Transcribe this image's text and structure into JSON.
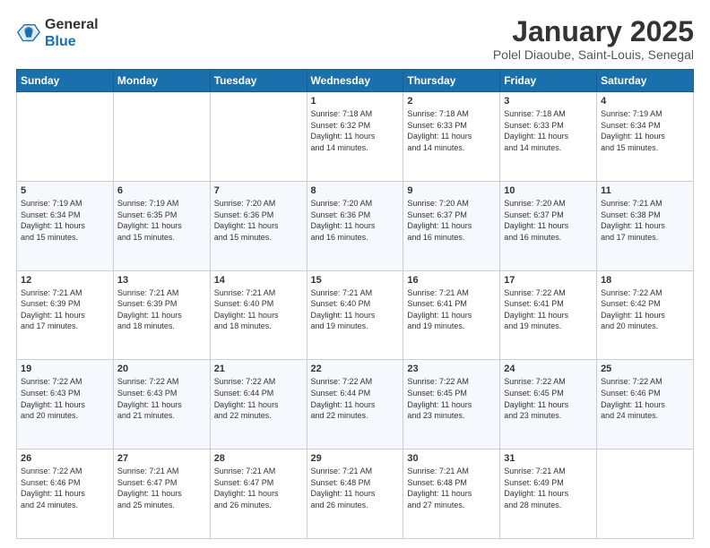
{
  "header": {
    "logo_line1": "General",
    "logo_line2": "Blue",
    "title": "January 2025",
    "subtitle": "Polel Diaoube, Saint-Louis, Senegal"
  },
  "weekdays": [
    "Sunday",
    "Monday",
    "Tuesday",
    "Wednesday",
    "Thursday",
    "Friday",
    "Saturday"
  ],
  "weeks": [
    [
      {
        "day": "",
        "info": ""
      },
      {
        "day": "",
        "info": ""
      },
      {
        "day": "",
        "info": ""
      },
      {
        "day": "1",
        "info": "Sunrise: 7:18 AM\nSunset: 6:32 PM\nDaylight: 11 hours\nand 14 minutes."
      },
      {
        "day": "2",
        "info": "Sunrise: 7:18 AM\nSunset: 6:33 PM\nDaylight: 11 hours\nand 14 minutes."
      },
      {
        "day": "3",
        "info": "Sunrise: 7:18 AM\nSunset: 6:33 PM\nDaylight: 11 hours\nand 14 minutes."
      },
      {
        "day": "4",
        "info": "Sunrise: 7:19 AM\nSunset: 6:34 PM\nDaylight: 11 hours\nand 15 minutes."
      }
    ],
    [
      {
        "day": "5",
        "info": "Sunrise: 7:19 AM\nSunset: 6:34 PM\nDaylight: 11 hours\nand 15 minutes."
      },
      {
        "day": "6",
        "info": "Sunrise: 7:19 AM\nSunset: 6:35 PM\nDaylight: 11 hours\nand 15 minutes."
      },
      {
        "day": "7",
        "info": "Sunrise: 7:20 AM\nSunset: 6:36 PM\nDaylight: 11 hours\nand 15 minutes."
      },
      {
        "day": "8",
        "info": "Sunrise: 7:20 AM\nSunset: 6:36 PM\nDaylight: 11 hours\nand 16 minutes."
      },
      {
        "day": "9",
        "info": "Sunrise: 7:20 AM\nSunset: 6:37 PM\nDaylight: 11 hours\nand 16 minutes."
      },
      {
        "day": "10",
        "info": "Sunrise: 7:20 AM\nSunset: 6:37 PM\nDaylight: 11 hours\nand 16 minutes."
      },
      {
        "day": "11",
        "info": "Sunrise: 7:21 AM\nSunset: 6:38 PM\nDaylight: 11 hours\nand 17 minutes."
      }
    ],
    [
      {
        "day": "12",
        "info": "Sunrise: 7:21 AM\nSunset: 6:39 PM\nDaylight: 11 hours\nand 17 minutes."
      },
      {
        "day": "13",
        "info": "Sunrise: 7:21 AM\nSunset: 6:39 PM\nDaylight: 11 hours\nand 18 minutes."
      },
      {
        "day": "14",
        "info": "Sunrise: 7:21 AM\nSunset: 6:40 PM\nDaylight: 11 hours\nand 18 minutes."
      },
      {
        "day": "15",
        "info": "Sunrise: 7:21 AM\nSunset: 6:40 PM\nDaylight: 11 hours\nand 19 minutes."
      },
      {
        "day": "16",
        "info": "Sunrise: 7:21 AM\nSunset: 6:41 PM\nDaylight: 11 hours\nand 19 minutes."
      },
      {
        "day": "17",
        "info": "Sunrise: 7:22 AM\nSunset: 6:41 PM\nDaylight: 11 hours\nand 19 minutes."
      },
      {
        "day": "18",
        "info": "Sunrise: 7:22 AM\nSunset: 6:42 PM\nDaylight: 11 hours\nand 20 minutes."
      }
    ],
    [
      {
        "day": "19",
        "info": "Sunrise: 7:22 AM\nSunset: 6:43 PM\nDaylight: 11 hours\nand 20 minutes."
      },
      {
        "day": "20",
        "info": "Sunrise: 7:22 AM\nSunset: 6:43 PM\nDaylight: 11 hours\nand 21 minutes."
      },
      {
        "day": "21",
        "info": "Sunrise: 7:22 AM\nSunset: 6:44 PM\nDaylight: 11 hours\nand 22 minutes."
      },
      {
        "day": "22",
        "info": "Sunrise: 7:22 AM\nSunset: 6:44 PM\nDaylight: 11 hours\nand 22 minutes."
      },
      {
        "day": "23",
        "info": "Sunrise: 7:22 AM\nSunset: 6:45 PM\nDaylight: 11 hours\nand 23 minutes."
      },
      {
        "day": "24",
        "info": "Sunrise: 7:22 AM\nSunset: 6:45 PM\nDaylight: 11 hours\nand 23 minutes."
      },
      {
        "day": "25",
        "info": "Sunrise: 7:22 AM\nSunset: 6:46 PM\nDaylight: 11 hours\nand 24 minutes."
      }
    ],
    [
      {
        "day": "26",
        "info": "Sunrise: 7:22 AM\nSunset: 6:46 PM\nDaylight: 11 hours\nand 24 minutes."
      },
      {
        "day": "27",
        "info": "Sunrise: 7:21 AM\nSunset: 6:47 PM\nDaylight: 11 hours\nand 25 minutes."
      },
      {
        "day": "28",
        "info": "Sunrise: 7:21 AM\nSunset: 6:47 PM\nDaylight: 11 hours\nand 26 minutes."
      },
      {
        "day": "29",
        "info": "Sunrise: 7:21 AM\nSunset: 6:48 PM\nDaylight: 11 hours\nand 26 minutes."
      },
      {
        "day": "30",
        "info": "Sunrise: 7:21 AM\nSunset: 6:48 PM\nDaylight: 11 hours\nand 27 minutes."
      },
      {
        "day": "31",
        "info": "Sunrise: 7:21 AM\nSunset: 6:49 PM\nDaylight: 11 hours\nand 28 minutes."
      },
      {
        "day": "",
        "info": ""
      }
    ]
  ]
}
